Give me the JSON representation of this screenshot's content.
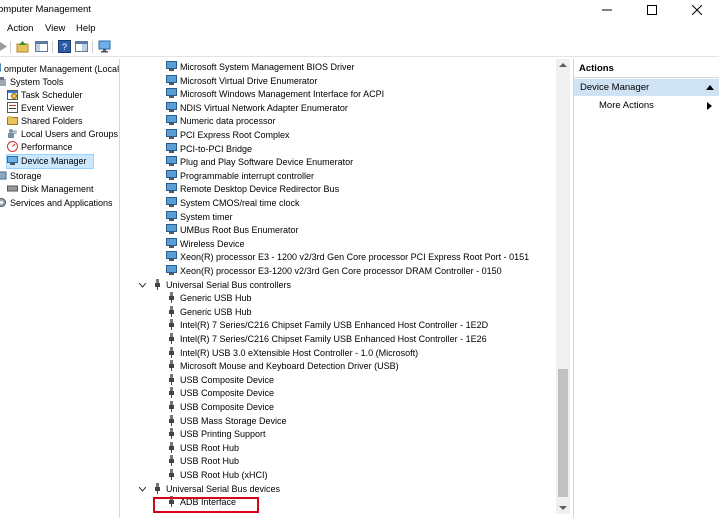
{
  "window": {
    "title": "omputer Management"
  },
  "menu": [
    "Action",
    "View",
    "Help"
  ],
  "left_tree": [
    {
      "label": "omputer Management (Local",
      "icon": "computer-icon",
      "indent": 0
    },
    {
      "label": "System Tools",
      "icon": "tools-icon",
      "indent": 0
    },
    {
      "label": "Task Scheduler",
      "icon": "task-scheduler-icon",
      "indent": 1
    },
    {
      "label": "Event Viewer",
      "icon": "event-viewer-icon",
      "indent": 1
    },
    {
      "label": "Shared Folders",
      "icon": "shared-folders-icon",
      "indent": 1
    },
    {
      "label": "Local Users and Groups",
      "icon": "users-icon",
      "indent": 1
    },
    {
      "label": "Performance",
      "icon": "performance-icon",
      "indent": 1
    },
    {
      "label": "Device Manager",
      "icon": "device-manager-icon",
      "indent": 1,
      "selected": true
    },
    {
      "label": "Storage",
      "icon": "storage-icon",
      "indent": 0
    },
    {
      "label": "Disk Management",
      "icon": "disk-icon",
      "indent": 1
    },
    {
      "label": "Services and Applications",
      "icon": "services-icon",
      "indent": 0
    }
  ],
  "devices": {
    "system_devices": [
      "Microsoft System Management BIOS Driver",
      "Microsoft Virtual Drive Enumerator",
      "Microsoft Windows Management Interface for ACPI",
      "NDIS Virtual Network Adapter Enumerator",
      "Numeric data processor",
      "PCI Express Root Complex",
      "PCI-to-PCI Bridge",
      "Plug and Play Software Device Enumerator",
      "Programmable interrupt controller",
      "Remote Desktop Device Redirector Bus",
      "System CMOS/real time clock",
      "System timer",
      "UMBus Root Bus Enumerator",
      "Wireless Device",
      "Xeon(R) processor E3 - 1200 v2/3rd Gen Core processor PCI Express Root Port - 0151",
      "Xeon(R) processor E3-1200 v2/3rd Gen Core processor DRAM Controller - 0150"
    ],
    "usb_controllers": {
      "label": "Universal Serial Bus controllers",
      "items": [
        "Generic USB Hub",
        "Generic USB Hub",
        "Intel(R) 7 Series/C216 Chipset Family USB Enhanced Host Controller - 1E2D",
        "Intel(R) 7 Series/C216 Chipset Family USB Enhanced Host Controller - 1E26",
        "Intel(R) USB 3.0 eXtensible Host Controller - 1.0 (Microsoft)",
        "Microsoft Mouse and Keyboard Detection Driver (USB)",
        "USB Composite Device",
        "USB Composite Device",
        "USB Composite Device",
        "USB Mass Storage Device",
        "USB Printing Support",
        "USB Root Hub",
        "USB Root Hub",
        "USB Root Hub (xHCI)"
      ]
    },
    "usb_devices": {
      "label": "Universal Serial Bus devices",
      "items": [
        "ADB Interface"
      ]
    }
  },
  "actions": {
    "header": "Actions",
    "section": "Device Manager",
    "more": "More Actions"
  },
  "colors": {
    "highlight": "#d8001a",
    "selection": "#cce8ff"
  }
}
